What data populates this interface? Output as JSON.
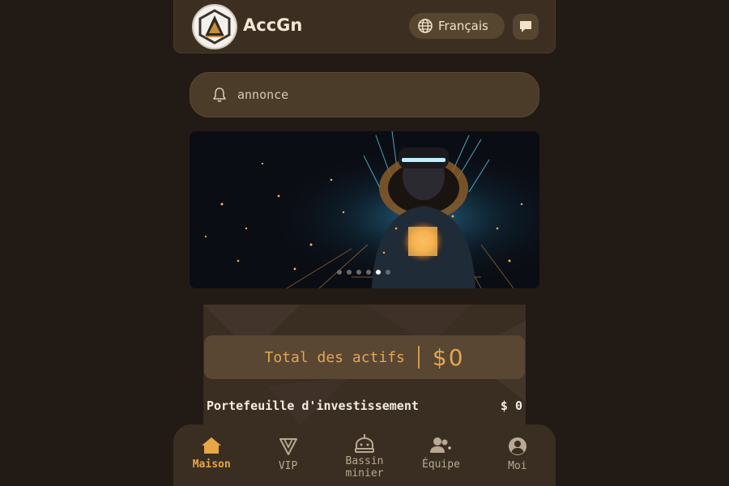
{
  "header": {
    "app_name": "AccGn",
    "language": "Français",
    "logo_icon": "accgn-logo-icon",
    "chat_icon": "chat-icon"
  },
  "announcement": {
    "icon": "bell-icon",
    "text": "annonce"
  },
  "banner": {
    "slide_count": 6,
    "active_slide": 4
  },
  "assets": {
    "total_label": "Total des actifs",
    "total_value": "$0",
    "wallet_label": "Portefeuille d'investissement",
    "wallet_value": "$ 0"
  },
  "nav": {
    "items": [
      {
        "label": "Maison",
        "icon": "home-icon",
        "active": true
      },
      {
        "label": "VIP",
        "icon": "vip-icon",
        "active": false
      },
      {
        "label": "Bassin minier",
        "icon": "mining-pool-icon",
        "active": false
      },
      {
        "label": "Équipe",
        "icon": "team-icon",
        "active": false
      },
      {
        "label": "Moi",
        "icon": "profile-icon",
        "active": false
      }
    ]
  },
  "colors": {
    "background": "#221a14",
    "accent": "#e2a74f",
    "card": "#3a2e22"
  }
}
